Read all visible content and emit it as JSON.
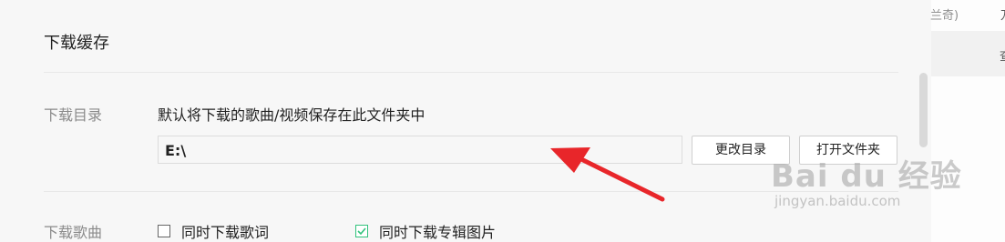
{
  "settings": {
    "section_title": "下载缓存",
    "download_dir": {
      "label": "下载目录",
      "description": "默认将下载的歌曲/视频保存在此文件夹中",
      "path_value": "E:\\",
      "change_button": "更改目录",
      "open_button": "打开文件夹"
    },
    "download_songs": {
      "label": "下载歌曲",
      "options": [
        {
          "label": "同时下载歌词",
          "checked": false
        },
        {
          "label": "同时下载专辑图片",
          "checked": true
        }
      ]
    }
  },
  "right_panel": {
    "text_top": "兰奇)",
    "text_top_right": "万",
    "text_row": "查"
  },
  "watermark": {
    "brand": "Bai du 经验",
    "url": "jingyan.baidu.com"
  },
  "colors": {
    "accent_green": "#31c27c",
    "annotation_arrow": "#e8262a"
  }
}
